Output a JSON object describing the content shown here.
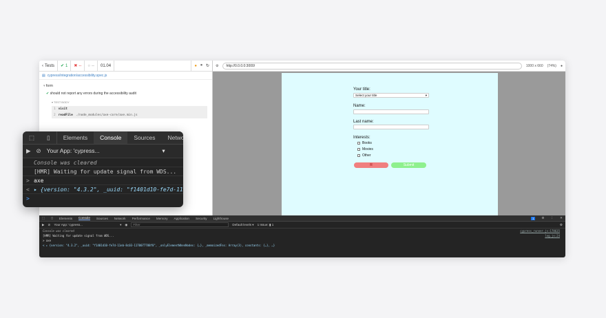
{
  "reporter": {
    "tests_label": "Tests",
    "passed": "1",
    "failed": "--",
    "pending": "--",
    "duration": "01.04",
    "spec_path": "cypress/integration/accessibility.spec.js",
    "suite": "form",
    "test_title": "should not report any errors during the accessibility audit",
    "test_body_label": "TEST BODY",
    "commands": [
      {
        "num": "1",
        "name": "visit",
        "arg": ""
      },
      {
        "num": "2",
        "name": "readFile",
        "arg": "./node_modules/axe-core/axe.min.js"
      }
    ]
  },
  "aut": {
    "url": "http://0.0.0.0:3000/",
    "viewport": "1000 x 660",
    "zoom": "(74%)"
  },
  "form": {
    "title_label": "Your title:",
    "title_select": "Select your title",
    "name_label": "Name:",
    "lastname_label": "Last name:",
    "interests_label": "Interests:",
    "interests": [
      "Books",
      "Movies",
      "Other"
    ],
    "reset_label": "R",
    "submit_label": "Submit"
  },
  "devtools_bottom": {
    "tabs": [
      "Elements",
      "Console",
      "Sources",
      "Network",
      "Performance",
      "Memory",
      "Application",
      "Security",
      "Lighthouse"
    ],
    "context": "Your App: 'cypress...",
    "filter_placeholder": "Filter",
    "levels": "Default levels ▾",
    "issues": "1 Issue: ▮ 1",
    "badge": "1",
    "lines": [
      {
        "text": "Console was cleared",
        "src": "cypress_runner.js:178635"
      },
      {
        "text": "[HMR] Waiting for update signal from WDS...",
        "src": "log.js:24"
      },
      {
        "text": "> axe",
        "src": ""
      },
      {
        "text": "< ▸ {version: \"4.3.2\", _uuid: \"f1401d10-fe7d-11eb-8c03-1170077788f8\", _onlyElementWhenNodes: {…}, _memoizedFns: Array(3), constants: {…}, …}",
        "src": ""
      }
    ]
  },
  "devtools_float": {
    "tabs": [
      "Elements",
      "Console",
      "Sources",
      "Networ"
    ],
    "context": "Your App: 'cypress...",
    "lines": [
      {
        "mark": "",
        "text": "Console was cleared"
      },
      {
        "mark": "",
        "text": "[HMR] Waiting for update signal from WDS..."
      },
      {
        "mark": ">",
        "text": "axe"
      },
      {
        "mark": "<",
        "text": "▸ {version: \"4.3.2\", _uuid: \"f1401d10-fe7d-11e"
      },
      {
        "mark": ">",
        "text": ""
      }
    ]
  },
  "colors": {
    "pass": "#1fa350",
    "fail": "#e34040",
    "accent": "#8ab4f8",
    "app_bg": "#dffcff"
  }
}
